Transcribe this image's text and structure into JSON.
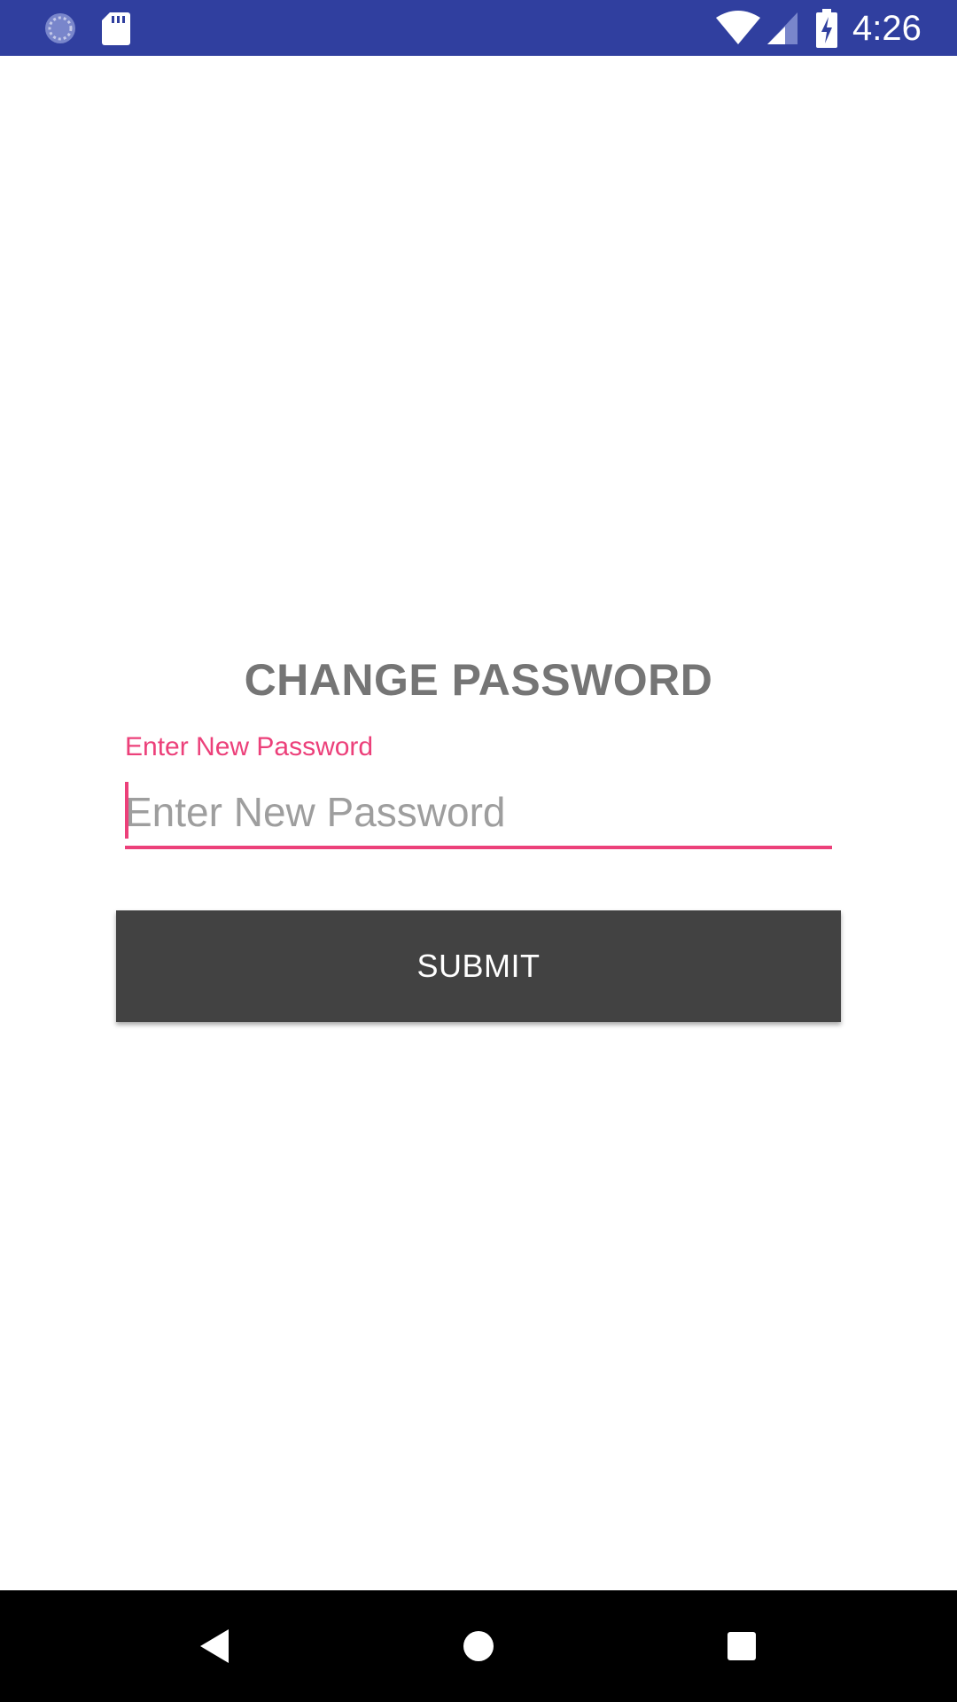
{
  "status_bar": {
    "background": "#303F9F",
    "time": "4:26",
    "left_icons": [
      "sync-icon",
      "sd-card-icon"
    ],
    "right_icons": [
      "wifi-icon",
      "signal-icon",
      "battery-charging-icon"
    ]
  },
  "form": {
    "title": "CHANGE PASSWORD",
    "password_field": {
      "floating_label": "Enter New Password",
      "placeholder": "Enter New Password",
      "value": "",
      "accent_color": "#EC407A"
    },
    "submit_label": "SUBMIT",
    "submit_color": "#424242"
  },
  "nav_bar": {
    "buttons": [
      "back-icon",
      "home-icon",
      "recents-icon"
    ]
  }
}
